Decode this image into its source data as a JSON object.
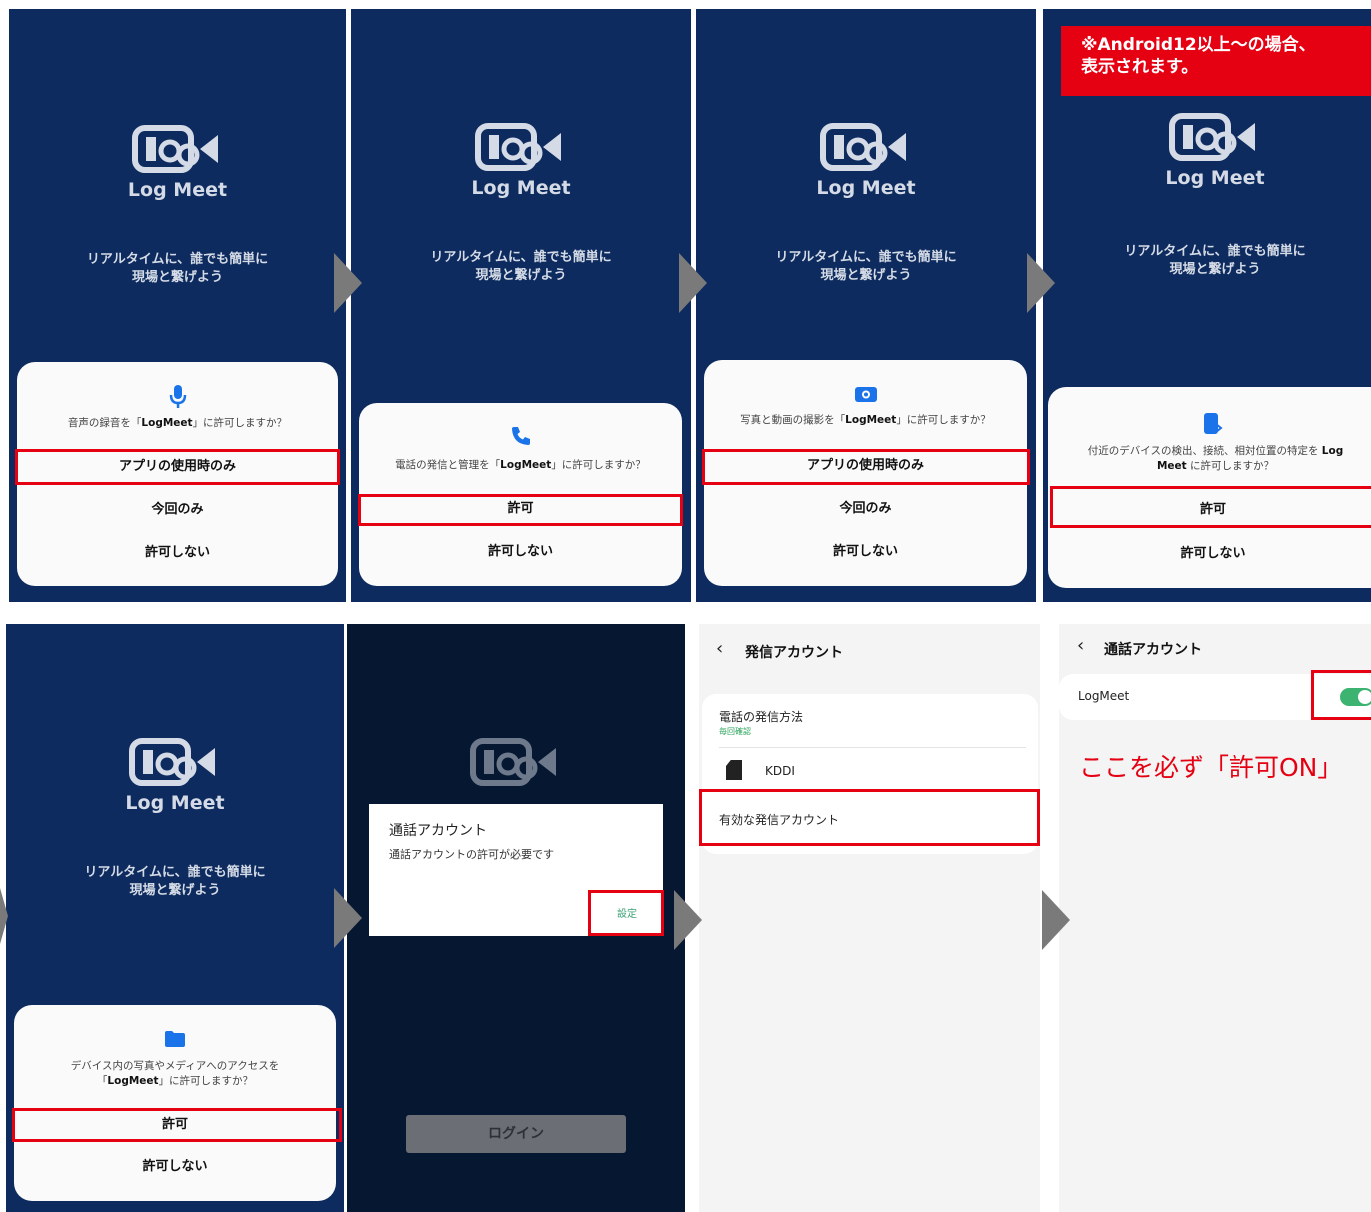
{
  "app": {
    "logo_name": "Log Meet",
    "tagline_line1": "リアルタイムに、誰でも簡単に",
    "tagline_line2": "現場と繋げよう"
  },
  "panel1": {
    "icon": "microphone-icon",
    "question_pre": "音声の録音を「",
    "question_app": "LogMeet",
    "question_post": "」に許可しますか？",
    "option1": "アプリの使用時のみ",
    "option2": "今回のみ",
    "option3": "許可しない"
  },
  "panel2": {
    "icon": "phone-icon",
    "question_pre": "電話の発信と管理を「",
    "question_app": "LogMeet",
    "question_post": "」に許可しますか？",
    "option1": "許可",
    "option2": "許可しない"
  },
  "panel3": {
    "icon": "camera-icon",
    "question_pre": "写真と動画の撮影を「",
    "question_app": "LogMeet",
    "question_post": "」に許可しますか？",
    "option1": "アプリの使用時のみ",
    "option2": "今回のみ",
    "option3": "許可しない"
  },
  "panel4": {
    "banner_line1": "※Android12以上〜の場合、",
    "banner_line2": "表示されます。",
    "icon": "nearby-devices-icon",
    "question_line1_pre": "付近のデバイスの検出、接続、相対位置の特定を ",
    "question_line1_app": "Log",
    "question_line2_app": "Meet",
    "question_line2_post": " に許可しますか？",
    "option1": "許可",
    "option2": "許可しない"
  },
  "panel5": {
    "icon": "folder-icon",
    "question_line1": "デバイス内の写真やメディアへのアクセスを",
    "question_line2_pre": "「",
    "question_line2_app": "LogMeet",
    "question_line2_post": "」に許可しますか？",
    "option1": "許可",
    "option2": "許可しない"
  },
  "panel6": {
    "dialog_title": "通話アカウント",
    "dialog_message": "通話アカウントの許可が必要です",
    "settings_button": "設定",
    "login_button": "ログイン"
  },
  "panel7": {
    "back_icon": "chevron-left-icon",
    "title": "発信アカウント",
    "row1_label": "電話の発信方法",
    "row1_sub": "毎回確認",
    "row2_icon": "sim-card-icon",
    "row2_label": "KDDI",
    "row3_label": "有効な発信アカウント"
  },
  "panel8": {
    "back_icon": "chevron-left-icon",
    "title": "通話アカウント",
    "row_label": "LogMeet",
    "note": "ここを必ず「許可ON」"
  },
  "colors": {
    "navy": "#0d2b5e",
    "highlight_red": "#e50012",
    "toggle_green": "#3cb371",
    "icon_blue": "#1a73e8"
  }
}
